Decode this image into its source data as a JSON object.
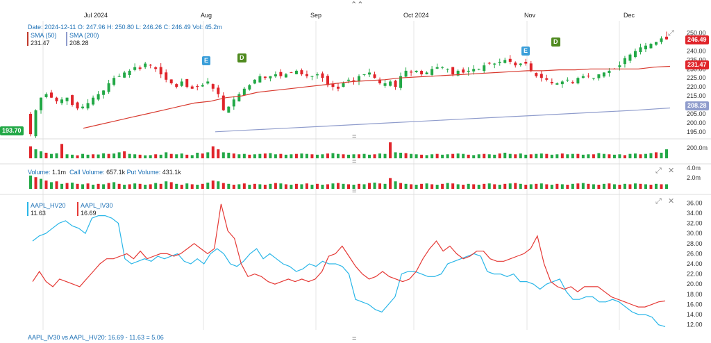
{
  "top_handle": "⌃⌃",
  "handles": [
    "=",
    "=",
    "=",
    "="
  ],
  "months": [
    "Jul 2024",
    "Aug",
    "Sep",
    "Oct 2024",
    "Nov",
    "Dec"
  ],
  "ohlc_line": {
    "date_label": "Date:",
    "date": "2024-12-11",
    "o_label": "O:",
    "o": "247.96",
    "h_label": "H:",
    "h": "250.80",
    "l_label": "L:",
    "l": "246.26",
    "c_label": "C:",
    "c": "246.49",
    "vol_label": "Vol:",
    "vol": "45.2m"
  },
  "sma_legend": [
    {
      "name": "SMA (50)",
      "value": "231.47",
      "color": "#c0392b"
    },
    {
      "name": "SMA (200)",
      "value": "208.28",
      "color": "#8f9ccc"
    }
  ],
  "price_tags": {
    "last": "246.49",
    "sma50": "231.47",
    "sma200": "208.28",
    "left": "193.70"
  },
  "markers": [
    {
      "letter": "E",
      "type": "earnings",
      "color": "#3a9ed9"
    },
    {
      "letter": "D",
      "type": "dividend",
      "color": "#4f8a1f"
    },
    {
      "letter": "E",
      "type": "earnings",
      "color": "#3a9ed9"
    },
    {
      "letter": "D",
      "type": "dividend",
      "color": "#4f8a1f"
    }
  ],
  "volume_axis": "200.0m",
  "options_legend": {
    "volume_label": "Volume:",
    "volume": "1.1m",
    "call_label": "Call Volume:",
    "call": "657.1k",
    "put_label": "Put Volume:",
    "put": "431.1k"
  },
  "options_axis": [
    "4.0m",
    "2.0m"
  ],
  "vol_legend": [
    {
      "name": "AAPL_HV20",
      "value": "11.63",
      "color": "#29b6e8"
    },
    {
      "name": "AAPL_IV30",
      "value": "16.69",
      "color": "#e53935"
    }
  ],
  "footer": "AAPL_IV30 vs AAPL_HV20: 16.69 - 11.63 = 5.06",
  "icons": {
    "expand": "⤢",
    "close": "✕"
  },
  "colors": {
    "up": "#22a846",
    "down": "#e0242a",
    "sma50": "#d83a2f",
    "sma200": "#8f9ccc",
    "hv20": "#29b6e8",
    "iv30": "#e53935"
  },
  "chart_data": [
    {
      "type": "candlestick",
      "x_range": [
        "2024-06-10",
        "2024-12-11"
      ],
      "y_axis_ticks": [
        195,
        200,
        205,
        210,
        215,
        220,
        225,
        230,
        235,
        240,
        245,
        250
      ],
      "ylim": [
        193,
        251
      ],
      "close": [
        193.7,
        207,
        214,
        216,
        214,
        212,
        213,
        214,
        210,
        208,
        209,
        211,
        214,
        216,
        218,
        222,
        225,
        226,
        228,
        229,
        231,
        230,
        233,
        232,
        230,
        227,
        224,
        222,
        220,
        223,
        220,
        219,
        220,
        221,
        223,
        219,
        216,
        207,
        209,
        213,
        216,
        219,
        221,
        224,
        226,
        225,
        226,
        227,
        226,
        227,
        228,
        229,
        227,
        226,
        226,
        227,
        225,
        221,
        220,
        219,
        222,
        224,
        223,
        226,
        227,
        228,
        225,
        222,
        222,
        223,
        220,
        226,
        229,
        228,
        229,
        227,
        228,
        230,
        231,
        231,
        230,
        227,
        229,
        228,
        229,
        230,
        230,
        232,
        233,
        233,
        234,
        235,
        234,
        232,
        233,
        233,
        229,
        226,
        225,
        224,
        222,
        222,
        223,
        224,
        222,
        225,
        226,
        226,
        225,
        227,
        228,
        229,
        230,
        232,
        236,
        238,
        240,
        242,
        243,
        244,
        245,
        247,
        246.49
      ],
      "sma50": [
        197,
        199,
        201,
        203,
        205,
        207,
        209,
        211,
        212,
        214,
        215,
        217,
        218,
        219,
        220,
        221,
        222,
        223,
        223.5,
        224,
        225,
        225.5,
        226,
        226.5,
        227,
        227.5,
        228,
        228.5,
        229,
        229,
        229.5,
        229.5,
        230,
        230,
        230,
        230,
        231,
        231.47
      ],
      "sma200": [
        195,
        196,
        197,
        198,
        199,
        200,
        201,
        202,
        203,
        204,
        205,
        206,
        207,
        208.28
      ],
      "series": [
        {
          "name": "SMA (50)",
          "value": 231.47
        },
        {
          "name": "SMA (200)",
          "value": 208.28
        }
      ],
      "last": {
        "date": "2024-12-11",
        "open": 247.96,
        "high": 250.8,
        "low": 246.26,
        "close": 246.49,
        "volume": "45.2m"
      }
    },
    {
      "type": "bar",
      "name": "Volume",
      "y_axis_ticks": [
        "200.0m"
      ],
      "values": [
        60,
        45,
        35,
        28,
        22,
        25,
        72,
        20,
        18,
        15,
        22,
        18,
        20,
        19,
        25,
        22,
        24,
        30,
        35,
        22,
        20,
        18,
        15,
        16,
        20,
        18,
        30,
        22,
        20,
        24,
        18,
        16,
        28,
        24,
        30,
        60,
        45,
        30,
        28,
        24,
        20,
        22,
        18,
        20,
        22,
        24,
        26,
        20,
        22,
        18,
        20,
        22,
        24,
        22,
        20,
        18,
        20,
        24,
        26,
        22,
        20,
        18,
        20,
        20,
        22,
        18,
        20,
        24,
        22,
        80,
        30,
        28,
        26,
        22,
        20,
        18,
        16,
        20,
        22,
        18,
        20,
        22,
        24,
        22,
        18,
        16,
        20,
        22,
        20,
        18,
        24,
        28,
        22,
        20,
        24,
        18,
        20,
        22,
        24,
        22,
        18,
        20,
        24,
        20,
        22,
        22,
        18,
        20,
        20,
        26,
        22,
        20,
        18,
        20,
        16,
        22,
        24,
        20,
        22,
        26,
        30,
        28,
        45
      ]
    },
    {
      "type": "bar",
      "name": "Options Volume",
      "y_axis_ticks": [
        "4.0m",
        "2.0m"
      ],
      "call_volume": "657.1k",
      "put_volume": "431.1k",
      "values": [
        3.2,
        2.8,
        2.4,
        2.0,
        1.6,
        1.8,
        1.2,
        1.4,
        1.5,
        1.2,
        1.1,
        1.3,
        1.0,
        1.2,
        1.1,
        1.4,
        1.6,
        1.2,
        1.0,
        1.1,
        1.3,
        1.2,
        1.0,
        1.1,
        1.4,
        1.2,
        1.8,
        1.6,
        1.2,
        1.0,
        1.3,
        1.1,
        1.0,
        1.2,
        1.5,
        2.0,
        1.8,
        1.4,
        1.2,
        1.0,
        1.1,
        1.3,
        1.0,
        1.2,
        1.1,
        1.0,
        1.2,
        1.4,
        1.3,
        1.1,
        1.0,
        1.2,
        1.1,
        1.3,
        1.0,
        1.2,
        1.0,
        1.1,
        1.3,
        1.4,
        1.2,
        1.1,
        1.0,
        1.2,
        1.1,
        1.4,
        1.5,
        1.3,
        1.2,
        2.6,
        1.8,
        1.4,
        1.2,
        1.1,
        1.0,
        1.2,
        1.3,
        1.1,
        1.0,
        1.2,
        1.4,
        1.3,
        1.1,
        1.0,
        1.2,
        1.1,
        1.0,
        1.2,
        1.3,
        1.1,
        1.0,
        1.2,
        1.3,
        1.4,
        1.2,
        1.0,
        1.1,
        1.2,
        1.3,
        1.1,
        1.0,
        1.2,
        1.1,
        1.0,
        1.2,
        1.3,
        1.4,
        1.2,
        1.1,
        1.0,
        1.2,
        1.3,
        1.1,
        1.0,
        1.2,
        1.1,
        1.3,
        1.2,
        1.1,
        1.0,
        1.2,
        1.1,
        1.1
      ]
    },
    {
      "type": "line",
      "y_axis_ticks": [
        12,
        14,
        16,
        18,
        20,
        22,
        24,
        26,
        28,
        30,
        32,
        34,
        36
      ],
      "ylim": [
        11,
        37
      ],
      "series": [
        {
          "name": "AAPL_HV20",
          "values": [
            28.5,
            29.5,
            30,
            31,
            32,
            32.5,
            31.5,
            31,
            30,
            33,
            33.5,
            33.5,
            33,
            32,
            25,
            24,
            24.5,
            25,
            24.5,
            25.5,
            25,
            25.5,
            26,
            24.5,
            24,
            25,
            24,
            26,
            27,
            26,
            24,
            23.5,
            24.5,
            26,
            27,
            25,
            26,
            25,
            24,
            23.5,
            22.5,
            23,
            24,
            23.5,
            24.5,
            24,
            24,
            23.5,
            22,
            17,
            16.5,
            16,
            15,
            14.5,
            16,
            17.5,
            22,
            22.5,
            22.5,
            22,
            21.5,
            21.5,
            22,
            24,
            24.5,
            25,
            25.5,
            26,
            25.5,
            22.5,
            22,
            22,
            21.5,
            22,
            20.5,
            20.5,
            20,
            19,
            20,
            20.5,
            21,
            18.5,
            17,
            17,
            17.5,
            17.5,
            16.5,
            16.5,
            17,
            16.5,
            15.5,
            14.5,
            14,
            14,
            13.5,
            12,
            11.63
          ]
        },
        {
          "name": "AAPL_IV30",
          "values": [
            20.5,
            22.5,
            20.5,
            19.5,
            21,
            20.5,
            20,
            19.5,
            21,
            22.5,
            24,
            25,
            25,
            25.5,
            26,
            25,
            26.5,
            25,
            25.5,
            26,
            26,
            25.5,
            26,
            27,
            28,
            27,
            26,
            27,
            35.8,
            30.5,
            29,
            24,
            21.5,
            22,
            21.5,
            20.5,
            20,
            20.5,
            21,
            20.5,
            21,
            20.5,
            21,
            22.5,
            25.5,
            26,
            27.5,
            25.5,
            23.5,
            22,
            21,
            21.5,
            22.5,
            21.5,
            21,
            20.5,
            21,
            22.5,
            25,
            27,
            28.5,
            26.5,
            27.5,
            26,
            25,
            25.5,
            26.5,
            26.5,
            25,
            24.5,
            24.5,
            25,
            25.5,
            26,
            27,
            29.5,
            24,
            20.5,
            19.5,
            19,
            19.5,
            18.5,
            19.5,
            19.5,
            19.5,
            18.5,
            17.5,
            17,
            16.5,
            16,
            15.5,
            15.5,
            16,
            16.5,
            16.69
          ]
        }
      ],
      "spread": "16.69 - 11.63 = 5.06"
    }
  ]
}
